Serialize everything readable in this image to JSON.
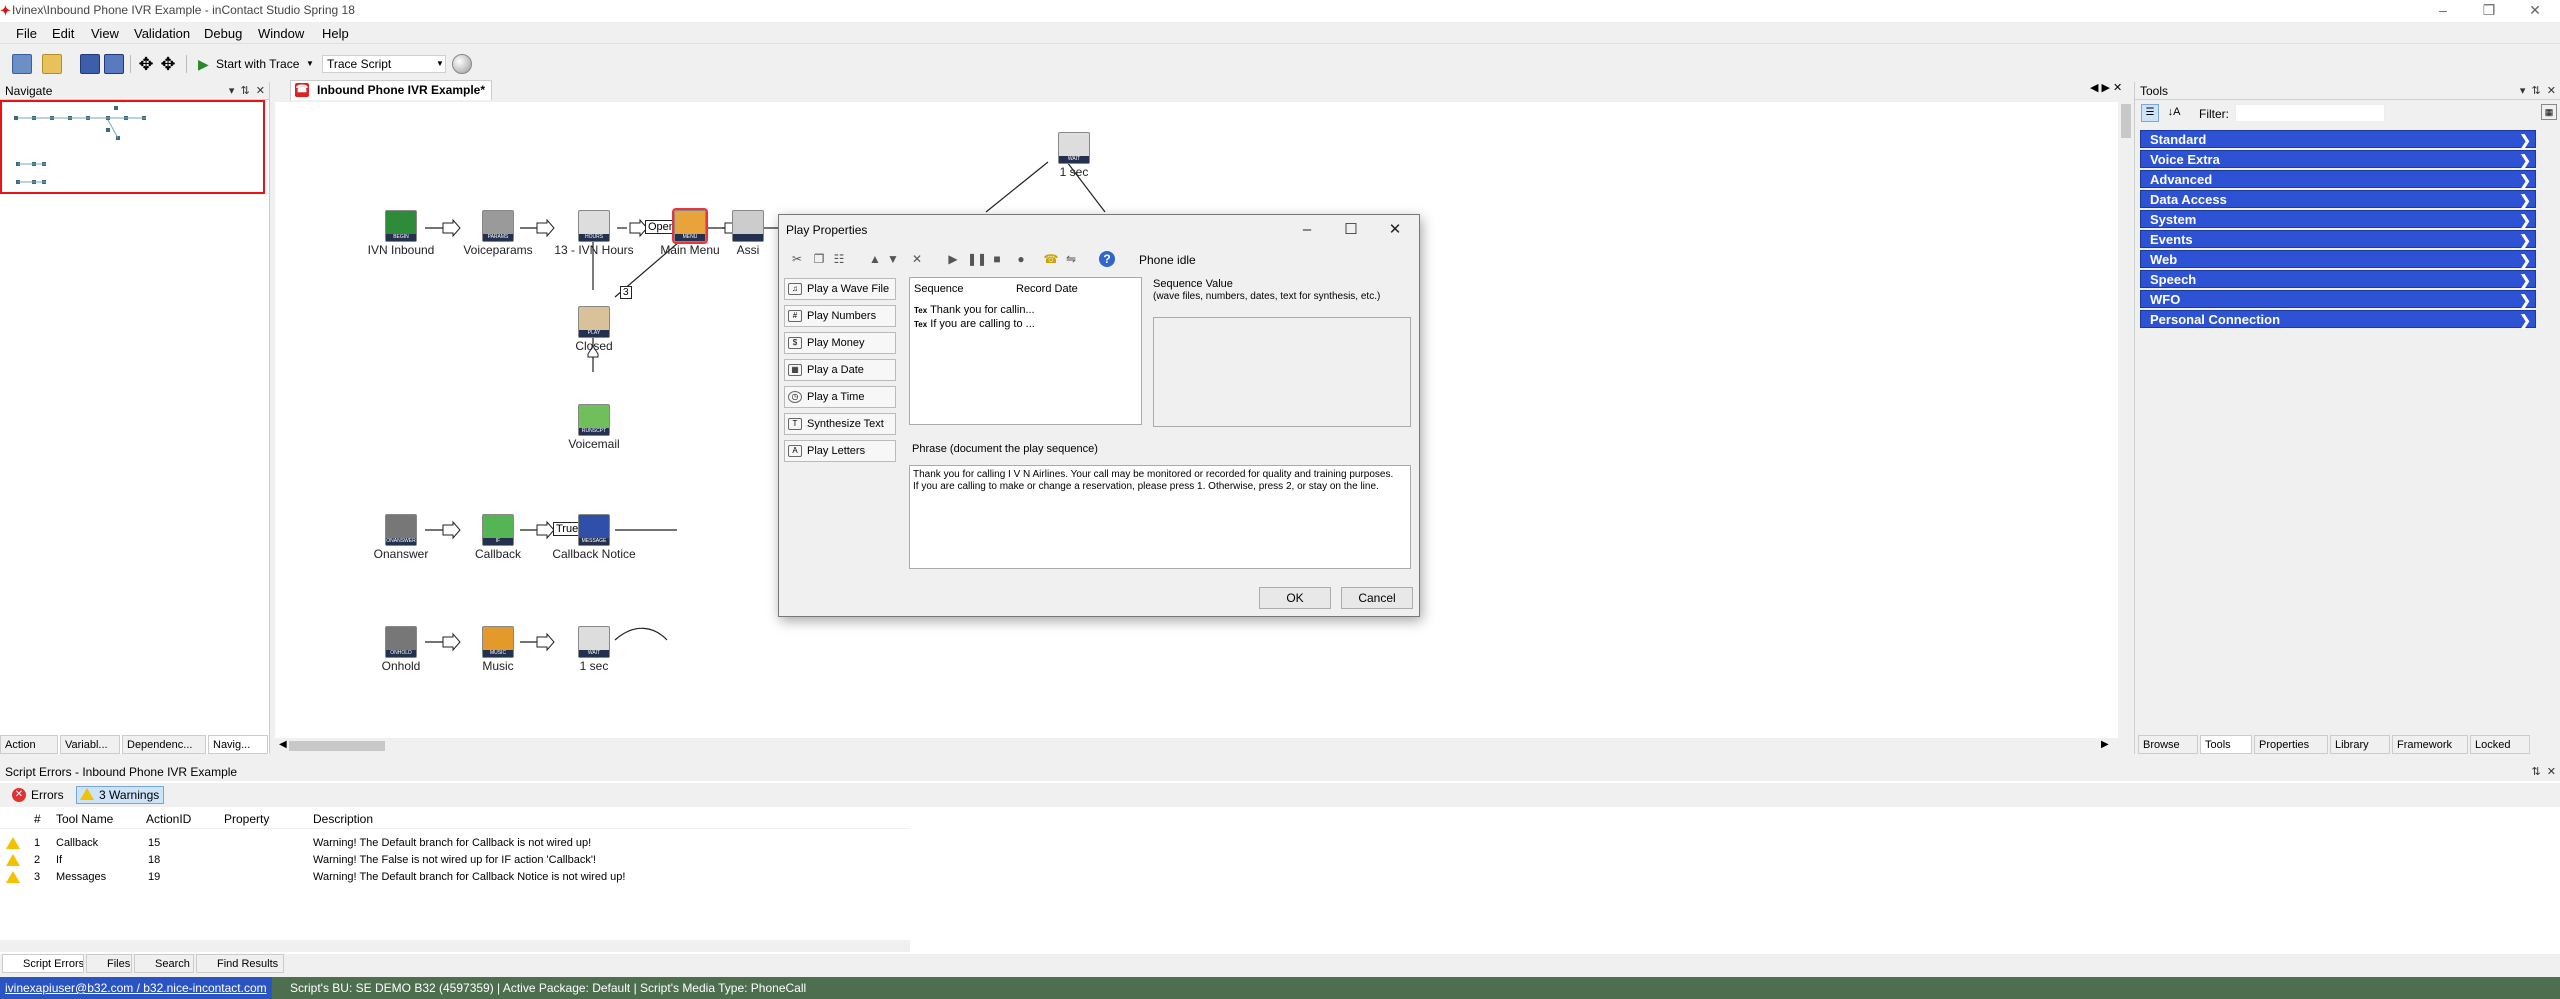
{
  "window": {
    "title": "Ivinex\\Inbound Phone IVR Example - inContact Studio Spring 18"
  },
  "menu": [
    "File",
    "Edit",
    "View",
    "Validation",
    "Debug",
    "Window",
    "Help"
  ],
  "toolbar": {
    "start_trace": "Start with Trace",
    "trace_combo": "Trace Script"
  },
  "navigate": {
    "title": "Navigate"
  },
  "document": {
    "tab": "Inbound Phone IVR Example*"
  },
  "nodes": [
    {
      "label": "IVN Inbound",
      "badge": "BEGIN",
      "color": "#2e8b3a"
    },
    {
      "label": "Voiceparams",
      "badge": "PARAMS",
      "color": "#9a9a9a"
    },
    {
      "label": "13 - IVN Hours",
      "badge": "HOURS",
      "color": "#dddddd"
    },
    {
      "label": "Main Menu",
      "badge": "MENU",
      "color": "#e8a43b"
    },
    {
      "label": "Assi",
      "badge": "",
      "color": "#cccccc"
    },
    {
      "label": "1 sec",
      "badge": "WAIT",
      "color": "#dddddd"
    },
    {
      "label": "Closed",
      "badge": "PLAY",
      "color": "#d9c29a"
    },
    {
      "label": "Voicemail",
      "badge": "RUNSCPT",
      "color": "#6fbf5a"
    },
    {
      "label": "Onanswer",
      "badge": "ONANSWER",
      "color": "#777777"
    },
    {
      "label": "Callback",
      "badge": "IF",
      "color": "#55b555"
    },
    {
      "label": "Callback Notice",
      "badge": "MESSAGE",
      "color": "#2f4fa8"
    },
    {
      "label": "Onhold",
      "badge": "ONHOLD",
      "color": "#777777"
    },
    {
      "label": "Music",
      "badge": "MUSIC",
      "color": "#e39a2b"
    },
    {
      "label": "1 sec",
      "badge": "WAIT",
      "color": "#dddddd"
    }
  ],
  "connectors": {
    "open": "Open",
    "three": "3",
    "true_label": "True"
  },
  "tools": {
    "title": "Tools",
    "filter_label": "Filter:",
    "categories": [
      "Standard",
      "Voice Extra",
      "Advanced",
      "Data Access",
      "System",
      "Events",
      "Web",
      "Speech",
      "WFO",
      "Personal Connection"
    ],
    "tabs": [
      "Browse",
      "Tools",
      "Properties",
      "Library",
      "Framework",
      "Locked"
    ]
  },
  "left_tabs": [
    "Action",
    "Variabl...",
    "Dependenc...",
    "Navig..."
  ],
  "dialog": {
    "title": "Play Properties",
    "phone_status": "Phone idle",
    "side_buttons": [
      "Play a Wave File",
      "Play Numbers",
      "Play Money",
      "Play a Date",
      "Play a Time",
      "Synthesize Text",
      "Play Letters"
    ],
    "sequence_header": "Sequence",
    "record_date_header": "Record Date",
    "sequence_items": [
      "Thank you for callin...",
      "If you are calling to ..."
    ],
    "sequence_value_label": "Sequence Value",
    "sequence_value_hint": "(wave files, numbers, dates, text for synthesis, etc.)",
    "phrase_label": "Phrase (document the play sequence)",
    "phrase_line1": "Thank you for calling I V N Airlines. Your call may be monitored or recorded for quality and training purposes.",
    "phrase_line2": "If you are calling to make or change a reservation, please press 1. Otherwise, press 2, or stay on the line.",
    "ok": "OK",
    "cancel": "Cancel"
  },
  "errors": {
    "title": "Script Errors - Inbound Phone IVR Example",
    "errors_btn": "Errors",
    "warnings_btn": "3 Warnings",
    "columns": [
      "#",
      "Tool Name",
      "ActionID",
      "Property",
      "Description"
    ],
    "rows": [
      {
        "n": "1",
        "tool": "Callback",
        "id": "15",
        "prop": "",
        "desc": "Warning! The Default branch for Callback is not wired up!"
      },
      {
        "n": "2",
        "tool": "If",
        "id": "18",
        "prop": "",
        "desc": "Warning! The False is not wired up for IF action 'Callback'!"
      },
      {
        "n": "3",
        "tool": "Messages",
        "id": "19",
        "prop": "",
        "desc": "Warning! The Default branch for Callback Notice is not wired up!"
      }
    ],
    "tabs": [
      "Script Errors",
      "Files",
      "Search",
      "Find Results"
    ]
  },
  "status": {
    "user": "ivinexapiuser@b32.com / b32.nice-incontact.com",
    "info": "Script's BU: SE DEMO B32 (4597359) | Active Package: Default | Script's Media Type: PhoneCall"
  }
}
